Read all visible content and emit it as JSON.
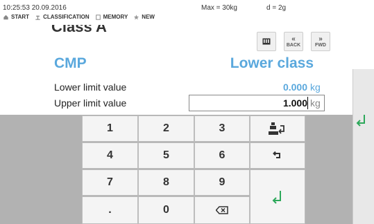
{
  "status": {
    "datetime": "10:25:53 20.09.2016",
    "max": "Max = 30kg",
    "d": "d = 2g"
  },
  "menu": [
    {
      "label": "START",
      "icon": "home-icon"
    },
    {
      "label": "CLASSIFICATION",
      "icon": "scale-icon"
    },
    {
      "label": "MEMORY",
      "icon": "memory-icon"
    },
    {
      "label": "NEW",
      "icon": "star-icon"
    }
  ],
  "page": {
    "title": "Class A",
    "left_heading": "CMP",
    "right_heading": "Lower class"
  },
  "toolbar": {
    "back_label": "BACK",
    "fwd_label": "FWD",
    "grid_icon": "keyboard-icon"
  },
  "fields": {
    "lower_label": "Lower limit value",
    "lower_value": "0.000",
    "lower_unit": "kg",
    "upper_label": "Upper limit value",
    "upper_value": "1.000",
    "upper_unit": "kg"
  },
  "keypad": {
    "k1": "1",
    "k2": "2",
    "k3": "3",
    "k4": "4",
    "k5": "5",
    "k6": "6",
    "k7": "7",
    "k8": "8",
    "k9": "9",
    "kdot": ".",
    "k0": "0"
  },
  "colors": {
    "accent_blue": "#5aa8dd",
    "enter_green": "#2ca85a",
    "keypad_bg": "#b2b2b2"
  }
}
